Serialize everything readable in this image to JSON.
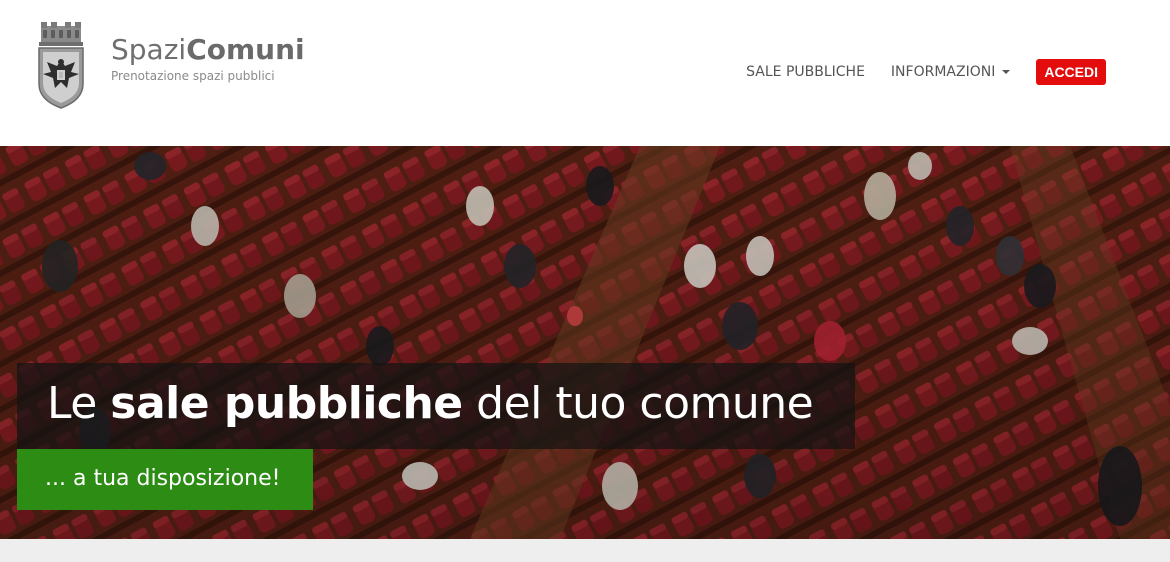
{
  "header": {
    "brand": {
      "title_light": "Spazi",
      "title_bold": "Comuni",
      "subtitle": "Prenotazione spazi pubblici",
      "emblem_icon": "coat-of-arms-eagle-icon"
    },
    "nav": {
      "items": [
        {
          "label": "SALE PUBBLICHE",
          "has_dropdown": false
        },
        {
          "label": "INFORMAZIONI",
          "has_dropdown": true
        }
      ],
      "login_label": "ACCEDI"
    }
  },
  "hero": {
    "title_part1": "Le ",
    "title_bold": "sale pubbliche",
    "title_part2": " del tuo comune",
    "subtitle": "... a tua disposizione!",
    "image": "auditorium-red-seats-photo"
  },
  "colors": {
    "accent_red": "#e30d0d",
    "accent_green": "#2c8c14",
    "text_gray": "#555555",
    "seat_red": "#8a1c22",
    "floor_brown": "#6a3a1e"
  }
}
